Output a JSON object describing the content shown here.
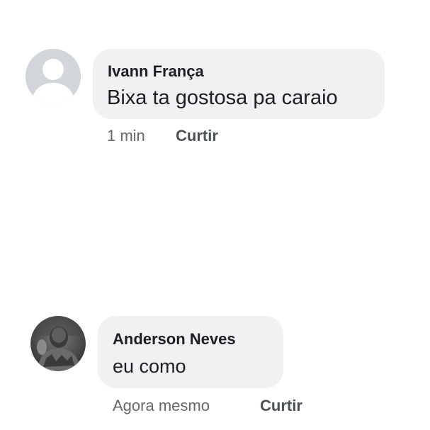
{
  "comments": [
    {
      "author": "Ivann França",
      "text": "Bixa ta gostosa pa caraio",
      "time": "1 min",
      "like_label": "Curtir",
      "avatar": "default-user-silhouette"
    },
    {
      "author": "Anderson Neves",
      "text": "eu como",
      "time": "Agora mesmo",
      "like_label": "Curtir",
      "avatar": "user-photo"
    }
  ]
}
